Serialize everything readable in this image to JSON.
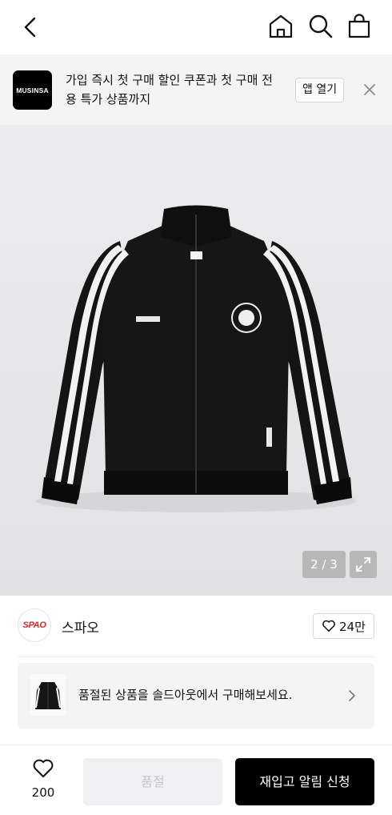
{
  "nav": {
    "back_icon": "chevron-left-icon",
    "home_icon": "home-icon",
    "search_icon": "search-icon",
    "bag_icon": "shopping-bag-icon"
  },
  "promo": {
    "logo_text": "MUSINSA",
    "message": "가입 즉시 첫 구매 할인 쿠폰과 첫 구매 전용 특가 상품까지",
    "open_button": "앱 열기",
    "close_icon": "close-icon"
  },
  "gallery": {
    "counter": "2 / 3",
    "current": 2,
    "total": 3,
    "expand_icon": "expand-icon"
  },
  "brand": {
    "logo_text": "SPAO",
    "name": "스파오",
    "like_count": "24만",
    "accent_color": "#e0231f"
  },
  "soldout_notice": {
    "message": "품절된 상품을 솔드아웃에서 구매해보세요."
  },
  "bottom_bar": {
    "wish_count": "200",
    "soldout_label": "품절",
    "restock_label": "재입고 알림 신청"
  }
}
